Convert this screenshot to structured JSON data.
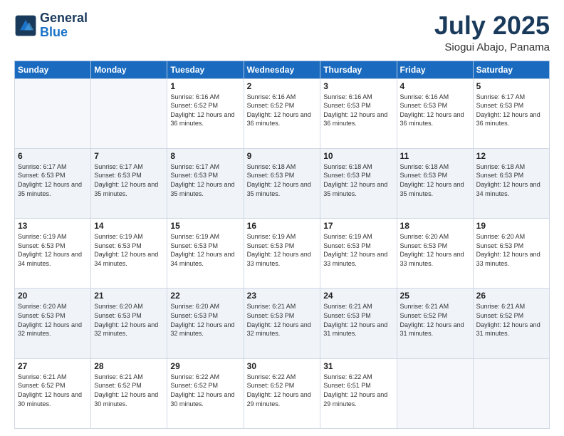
{
  "header": {
    "logo_line1": "General",
    "logo_line2": "Blue",
    "month": "July 2025",
    "location": "Siogui Abajo, Panama"
  },
  "weekdays": [
    "Sunday",
    "Monday",
    "Tuesday",
    "Wednesday",
    "Thursday",
    "Friday",
    "Saturday"
  ],
  "weeks": [
    [
      {
        "day": "",
        "sunrise": "",
        "sunset": "",
        "daylight": ""
      },
      {
        "day": "",
        "sunrise": "",
        "sunset": "",
        "daylight": ""
      },
      {
        "day": "1",
        "sunrise": "Sunrise: 6:16 AM",
        "sunset": "Sunset: 6:52 PM",
        "daylight": "Daylight: 12 hours and 36 minutes."
      },
      {
        "day": "2",
        "sunrise": "Sunrise: 6:16 AM",
        "sunset": "Sunset: 6:52 PM",
        "daylight": "Daylight: 12 hours and 36 minutes."
      },
      {
        "day": "3",
        "sunrise": "Sunrise: 6:16 AM",
        "sunset": "Sunset: 6:53 PM",
        "daylight": "Daylight: 12 hours and 36 minutes."
      },
      {
        "day": "4",
        "sunrise": "Sunrise: 6:16 AM",
        "sunset": "Sunset: 6:53 PM",
        "daylight": "Daylight: 12 hours and 36 minutes."
      },
      {
        "day": "5",
        "sunrise": "Sunrise: 6:17 AM",
        "sunset": "Sunset: 6:53 PM",
        "daylight": "Daylight: 12 hours and 36 minutes."
      }
    ],
    [
      {
        "day": "6",
        "sunrise": "Sunrise: 6:17 AM",
        "sunset": "Sunset: 6:53 PM",
        "daylight": "Daylight: 12 hours and 35 minutes."
      },
      {
        "day": "7",
        "sunrise": "Sunrise: 6:17 AM",
        "sunset": "Sunset: 6:53 PM",
        "daylight": "Daylight: 12 hours and 35 minutes."
      },
      {
        "day": "8",
        "sunrise": "Sunrise: 6:17 AM",
        "sunset": "Sunset: 6:53 PM",
        "daylight": "Daylight: 12 hours and 35 minutes."
      },
      {
        "day": "9",
        "sunrise": "Sunrise: 6:18 AM",
        "sunset": "Sunset: 6:53 PM",
        "daylight": "Daylight: 12 hours and 35 minutes."
      },
      {
        "day": "10",
        "sunrise": "Sunrise: 6:18 AM",
        "sunset": "Sunset: 6:53 PM",
        "daylight": "Daylight: 12 hours and 35 minutes."
      },
      {
        "day": "11",
        "sunrise": "Sunrise: 6:18 AM",
        "sunset": "Sunset: 6:53 PM",
        "daylight": "Daylight: 12 hours and 35 minutes."
      },
      {
        "day": "12",
        "sunrise": "Sunrise: 6:18 AM",
        "sunset": "Sunset: 6:53 PM",
        "daylight": "Daylight: 12 hours and 34 minutes."
      }
    ],
    [
      {
        "day": "13",
        "sunrise": "Sunrise: 6:19 AM",
        "sunset": "Sunset: 6:53 PM",
        "daylight": "Daylight: 12 hours and 34 minutes."
      },
      {
        "day": "14",
        "sunrise": "Sunrise: 6:19 AM",
        "sunset": "Sunset: 6:53 PM",
        "daylight": "Daylight: 12 hours and 34 minutes."
      },
      {
        "day": "15",
        "sunrise": "Sunrise: 6:19 AM",
        "sunset": "Sunset: 6:53 PM",
        "daylight": "Daylight: 12 hours and 34 minutes."
      },
      {
        "day": "16",
        "sunrise": "Sunrise: 6:19 AM",
        "sunset": "Sunset: 6:53 PM",
        "daylight": "Daylight: 12 hours and 33 minutes."
      },
      {
        "day": "17",
        "sunrise": "Sunrise: 6:19 AM",
        "sunset": "Sunset: 6:53 PM",
        "daylight": "Daylight: 12 hours and 33 minutes."
      },
      {
        "day": "18",
        "sunrise": "Sunrise: 6:20 AM",
        "sunset": "Sunset: 6:53 PM",
        "daylight": "Daylight: 12 hours and 33 minutes."
      },
      {
        "day": "19",
        "sunrise": "Sunrise: 6:20 AM",
        "sunset": "Sunset: 6:53 PM",
        "daylight": "Daylight: 12 hours and 33 minutes."
      }
    ],
    [
      {
        "day": "20",
        "sunrise": "Sunrise: 6:20 AM",
        "sunset": "Sunset: 6:53 PM",
        "daylight": "Daylight: 12 hours and 32 minutes."
      },
      {
        "day": "21",
        "sunrise": "Sunrise: 6:20 AM",
        "sunset": "Sunset: 6:53 PM",
        "daylight": "Daylight: 12 hours and 32 minutes."
      },
      {
        "day": "22",
        "sunrise": "Sunrise: 6:20 AM",
        "sunset": "Sunset: 6:53 PM",
        "daylight": "Daylight: 12 hours and 32 minutes."
      },
      {
        "day": "23",
        "sunrise": "Sunrise: 6:21 AM",
        "sunset": "Sunset: 6:53 PM",
        "daylight": "Daylight: 12 hours and 32 minutes."
      },
      {
        "day": "24",
        "sunrise": "Sunrise: 6:21 AM",
        "sunset": "Sunset: 6:53 PM",
        "daylight": "Daylight: 12 hours and 31 minutes."
      },
      {
        "day": "25",
        "sunrise": "Sunrise: 6:21 AM",
        "sunset": "Sunset: 6:52 PM",
        "daylight": "Daylight: 12 hours and 31 minutes."
      },
      {
        "day": "26",
        "sunrise": "Sunrise: 6:21 AM",
        "sunset": "Sunset: 6:52 PM",
        "daylight": "Daylight: 12 hours and 31 minutes."
      }
    ],
    [
      {
        "day": "27",
        "sunrise": "Sunrise: 6:21 AM",
        "sunset": "Sunset: 6:52 PM",
        "daylight": "Daylight: 12 hours and 30 minutes."
      },
      {
        "day": "28",
        "sunrise": "Sunrise: 6:21 AM",
        "sunset": "Sunset: 6:52 PM",
        "daylight": "Daylight: 12 hours and 30 minutes."
      },
      {
        "day": "29",
        "sunrise": "Sunrise: 6:22 AM",
        "sunset": "Sunset: 6:52 PM",
        "daylight": "Daylight: 12 hours and 30 minutes."
      },
      {
        "day": "30",
        "sunrise": "Sunrise: 6:22 AM",
        "sunset": "Sunset: 6:52 PM",
        "daylight": "Daylight: 12 hours and 29 minutes."
      },
      {
        "day": "31",
        "sunrise": "Sunrise: 6:22 AM",
        "sunset": "Sunset: 6:51 PM",
        "daylight": "Daylight: 12 hours and 29 minutes."
      },
      {
        "day": "",
        "sunrise": "",
        "sunset": "",
        "daylight": ""
      },
      {
        "day": "",
        "sunrise": "",
        "sunset": "",
        "daylight": ""
      }
    ]
  ]
}
